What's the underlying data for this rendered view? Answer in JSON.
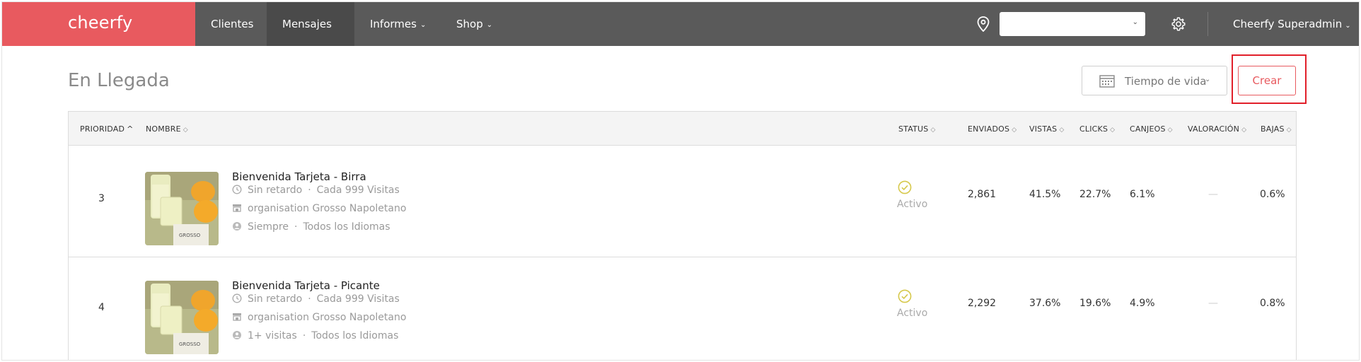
{
  "app": {
    "logo": "cheerfy",
    "nav": [
      {
        "label": "Clientes",
        "has_dropdown": false,
        "active": false
      },
      {
        "label": "Mensajes",
        "has_dropdown": true,
        "active": true
      },
      {
        "label": "Informes",
        "has_dropdown": true,
        "active": false
      },
      {
        "label": "Shop",
        "has_dropdown": true,
        "active": false
      }
    ],
    "location_select": {
      "value": ""
    },
    "user_menu": {
      "label": "Cheerfy Superadmin"
    },
    "colors": {
      "brand": "#e85a5f",
      "topbar": "#5a5a5a",
      "active_nav": "#4a4a4a",
      "status_ok": "#d6c84a"
    }
  },
  "page": {
    "title": "En Llegada",
    "period_button": {
      "label": "Tiempo de vida"
    },
    "create_button": {
      "label": "Crear"
    }
  },
  "table": {
    "columns": [
      "PRIORIDAD",
      "NOMBRE",
      "STATUS",
      "ENVIADOS",
      "VISTAS",
      "CLICKS",
      "CANJEOS",
      "VALORACIÓN",
      "BAJAS"
    ],
    "rows": [
      {
        "priority": "3",
        "name": "Bienvenida Tarjeta - Birra",
        "delay": "Sin retardo",
        "frequency": "Cada 999 Visitas",
        "organisation": "organisation Grosso Napoletano",
        "audience": "Siempre",
        "languages": "Todos los Idiomas",
        "status": "Activo",
        "enviados": "2,861",
        "vistas": "41.5%",
        "clicks": "22.7%",
        "canjeos": "6.1%",
        "valoracion": "—",
        "bajas": "0.6%"
      },
      {
        "priority": "4",
        "name": "Bienvenida Tarjeta - Picante",
        "delay": "Sin retardo",
        "frequency": "Cada 999 Visitas",
        "organisation": "organisation Grosso Napoletano",
        "audience": "1+ visitas",
        "languages": "Todos los Idiomas",
        "status": "Activo",
        "enviados": "2,292",
        "vistas": "37.6%",
        "clicks": "19.6%",
        "canjeos": "4.9%",
        "valoracion": "—",
        "bajas": "0.8%"
      }
    ]
  }
}
